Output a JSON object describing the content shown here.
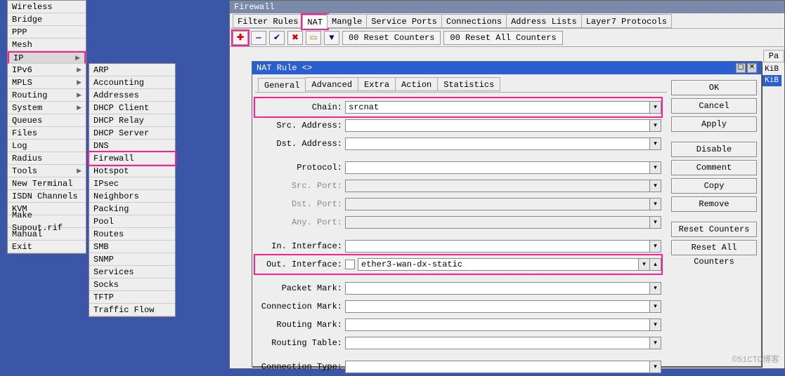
{
  "main_menu": {
    "items": [
      {
        "label": "Wireless",
        "arrow": false
      },
      {
        "label": "Bridge",
        "arrow": false
      },
      {
        "label": "PPP",
        "arrow": false
      },
      {
        "label": "Mesh",
        "arrow": false
      },
      {
        "label": "IP",
        "arrow": true,
        "hl": true
      },
      {
        "label": "IPv6",
        "arrow": true
      },
      {
        "label": "MPLS",
        "arrow": true
      },
      {
        "label": "Routing",
        "arrow": true
      },
      {
        "label": "System",
        "arrow": true
      },
      {
        "label": "Queues",
        "arrow": false
      },
      {
        "label": "Files",
        "arrow": false
      },
      {
        "label": "Log",
        "arrow": false
      },
      {
        "label": "Radius",
        "arrow": false
      },
      {
        "label": "Tools",
        "arrow": true
      },
      {
        "label": "New Terminal",
        "arrow": false
      },
      {
        "label": "ISDN Channels",
        "arrow": false
      },
      {
        "label": "KVM",
        "arrow": false
      },
      {
        "label": "Make Supout.rif",
        "arrow": false
      },
      {
        "label": "Manual",
        "arrow": false
      },
      {
        "label": "Exit",
        "arrow": false
      }
    ]
  },
  "sub_menu": {
    "items": [
      {
        "label": "ARP"
      },
      {
        "label": "Accounting"
      },
      {
        "label": "Addresses"
      },
      {
        "label": "DHCP Client"
      },
      {
        "label": "DHCP Relay"
      },
      {
        "label": "DHCP Server"
      },
      {
        "label": "DNS"
      },
      {
        "label": "Firewall",
        "hl": true
      },
      {
        "label": "Hotspot"
      },
      {
        "label": "IPsec"
      },
      {
        "label": "Neighbors"
      },
      {
        "label": "Packing"
      },
      {
        "label": "Pool"
      },
      {
        "label": "Routes"
      },
      {
        "label": "SMB"
      },
      {
        "label": "SNMP"
      },
      {
        "label": "Services"
      },
      {
        "label": "Socks"
      },
      {
        "label": "TFTP"
      },
      {
        "label": "Traffic Flow"
      }
    ]
  },
  "firewall": {
    "title": "Firewall",
    "tabs": [
      "Filter Rules",
      "NAT",
      "Mangle",
      "Service Ports",
      "Connections",
      "Address Lists",
      "Layer7 Protocols"
    ],
    "active_tab": 1,
    "toolbar": {
      "reset1": "00 Reset Counters",
      "reset2": "00 Reset All Counters"
    },
    "col_head": "Pa",
    "rows": [
      {
        "bytes": "4 KiB",
        "sel": false
      },
      {
        "bytes": "4 KiB",
        "sel": true
      }
    ]
  },
  "dialog": {
    "title": "NAT Rule <>",
    "tabs": [
      "General",
      "Advanced",
      "Extra",
      "Action",
      "Statistics"
    ],
    "active_tab": 0,
    "fields": {
      "chain": {
        "label": "Chain:",
        "value": "srcnat"
      },
      "src_addr": {
        "label": "Src. Address:",
        "value": ""
      },
      "dst_addr": {
        "label": "Dst. Address:",
        "value": ""
      },
      "protocol": {
        "label": "Protocol:",
        "value": ""
      },
      "src_port": {
        "label": "Src. Port:",
        "value": "",
        "dim": true
      },
      "dst_port": {
        "label": "Dst. Port:",
        "value": "",
        "dim": true
      },
      "any_port": {
        "label": "Any. Port:",
        "value": "",
        "dim": true
      },
      "in_if": {
        "label": "In. Interface:",
        "value": ""
      },
      "out_if": {
        "label": "Out. Interface:",
        "value": "ether3-wan-dx-static"
      },
      "packet_mark": {
        "label": "Packet Mark:",
        "value": ""
      },
      "conn_mark": {
        "label": "Connection Mark:",
        "value": ""
      },
      "routing_mark": {
        "label": "Routing Mark:",
        "value": ""
      },
      "routing_table": {
        "label": "Routing Table:",
        "value": ""
      },
      "conn_type": {
        "label": "Connection Type:",
        "value": ""
      }
    },
    "buttons": [
      "OK",
      "Cancel",
      "Apply",
      "Disable",
      "Comment",
      "Copy",
      "Remove",
      "Reset Counters",
      "Reset All Counters"
    ]
  },
  "watermark": "©51CTO博客"
}
